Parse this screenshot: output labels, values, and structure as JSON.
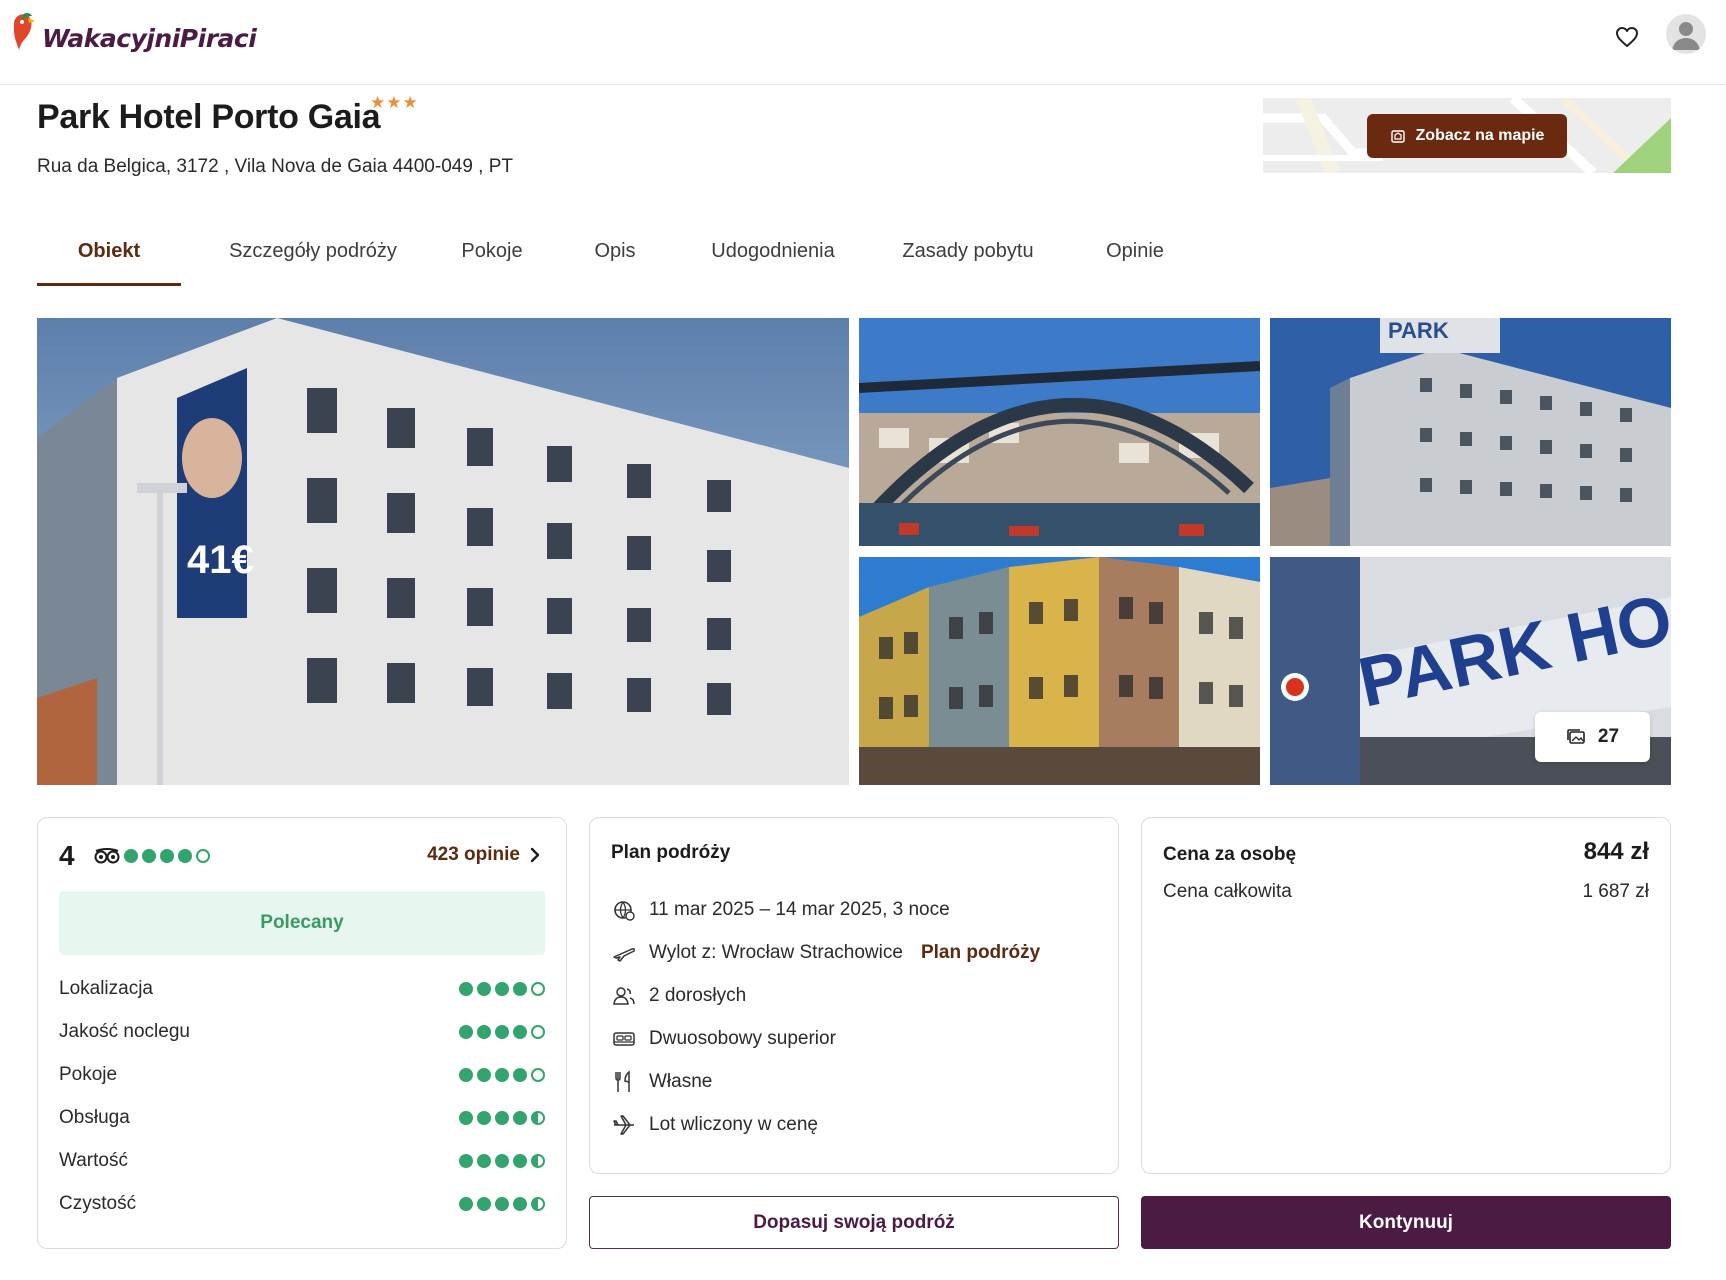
{
  "brand": {
    "name": "WakacyjniPiraci"
  },
  "header": {
    "favorites_icon": "heart-icon",
    "profile_icon": "user-icon"
  },
  "hotel": {
    "name": "Park Hotel Porto Gaia",
    "stars": "★★★",
    "star_count": 3,
    "address": "Rua da Belgica, 3172 , Vila Nova de Gaia 4400-049 , PT"
  },
  "map": {
    "button_label": "Zobacz na mapie",
    "icon": "map-pin-icon"
  },
  "tabs": [
    {
      "label": "Obiekt",
      "active": true
    },
    {
      "label": "Szczegóły podróży",
      "active": false
    },
    {
      "label": "Pokoje",
      "active": false
    },
    {
      "label": "Opis",
      "active": false
    },
    {
      "label": "Udogodnienia",
      "active": false
    },
    {
      "label": "Zasady pobytu",
      "active": false
    },
    {
      "label": "Opinie",
      "active": false
    }
  ],
  "gallery": {
    "photo_count": "27",
    "photos": [
      "hotel-facade",
      "porto-bridge",
      "hotel-exterior",
      "ribeira-houses",
      "hotel-sign"
    ]
  },
  "reviews": {
    "score": "4",
    "score_value": 4,
    "reviews_link": "423 opinie",
    "badge": "Polecany",
    "categories": [
      {
        "label": "Lokalizacja",
        "rating": 4
      },
      {
        "label": "Jakość noclegu",
        "rating": 4
      },
      {
        "label": "Pokoje",
        "rating": 4
      },
      {
        "label": "Obsługa",
        "rating": 4.5
      },
      {
        "label": "Wartość",
        "rating": 4.5
      },
      {
        "label": "Czystość",
        "rating": 4.5
      }
    ]
  },
  "plan": {
    "title": "Plan podróży",
    "dates": "11 mar 2025 – 14 mar 2025, 3 noce",
    "departure": "Wylot z: Wrocław Strachowice",
    "departure_link": "Plan podróży",
    "guests": "2 dorosłych",
    "room": "Dwuosobowy superior",
    "board": "Własne",
    "flight": "Lot wliczony w cenę"
  },
  "price": {
    "per_person_label": "Cena za osobę",
    "per_person_value": "844 zł",
    "total_label": "Cena całkowita",
    "total_value": "1 687 zł"
  },
  "actions": {
    "customize_label": "Dopasuj swoją podróż",
    "continue_label": "Kontynuuj"
  },
  "colors": {
    "brand": "#4b1b44",
    "accent": "#5b2a10",
    "rating_green": "#34a46e",
    "star_orange": "#e8913b"
  }
}
